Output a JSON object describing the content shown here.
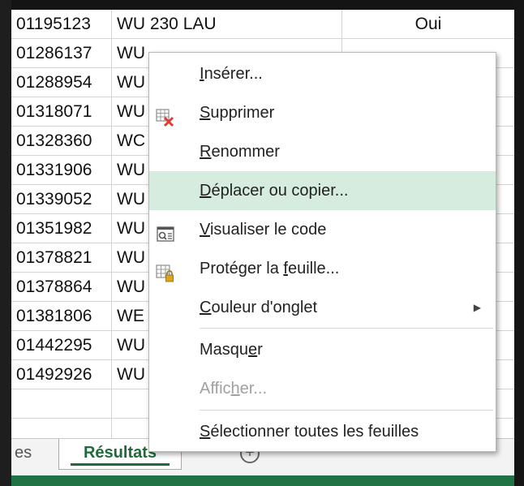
{
  "rows": [
    {
      "id": "01195123",
      "name": "WU 230 LAU",
      "value": "Oui"
    },
    {
      "id": "01286137",
      "name": "WU",
      "value": ""
    },
    {
      "id": "01288954",
      "name": "WU",
      "value": ""
    },
    {
      "id": "01318071",
      "name": "WU",
      "value": ""
    },
    {
      "id": "01328360",
      "name": "WC",
      "value": ""
    },
    {
      "id": "01331906",
      "name": "WU",
      "value": ""
    },
    {
      "id": "01339052",
      "name": "WU",
      "value": ""
    },
    {
      "id": "01351982",
      "name": "WU",
      "value": ""
    },
    {
      "id": "01378821",
      "name": "WU",
      "value": ""
    },
    {
      "id": "01378864",
      "name": "WU",
      "value": ""
    },
    {
      "id": "01381806",
      "name": "WE",
      "value": ""
    },
    {
      "id": "01442295",
      "name": "WU",
      "value": ""
    },
    {
      "id": "01492926",
      "name": "WU",
      "value": ""
    },
    {
      "id": "",
      "name": "",
      "value": ""
    },
    {
      "id": "",
      "name": "",
      "value": ""
    }
  ],
  "tabs": {
    "previous_partial": "es",
    "active": "Résultats",
    "add_symbol": "+"
  },
  "menu": {
    "insert": {
      "pre": "",
      "ul": "I",
      "post": "nsérer..."
    },
    "delete": {
      "pre": "",
      "ul": "S",
      "post": "upprimer"
    },
    "rename": {
      "pre": "",
      "ul": "R",
      "post": "enommer"
    },
    "move_copy": {
      "pre": "",
      "ul": "D",
      "post": "éplacer ou copier..."
    },
    "view_code": {
      "pre": "",
      "ul": "V",
      "post": "isualiser le code"
    },
    "protect": {
      "pre": "Protéger la ",
      "ul": "f",
      "post": "euille..."
    },
    "tab_color": {
      "pre": "",
      "ul": "C",
      "post": "ouleur d'onglet"
    },
    "hide": {
      "pre": "Masqu",
      "ul": "e",
      "post": "r"
    },
    "unhide": {
      "pre": "Affic",
      "ul": "h",
      "post": "er..."
    },
    "select_all": {
      "pre": "",
      "ul": "S",
      "post": "électionner toutes les feuilles"
    },
    "submenu_arrow": "▶"
  },
  "colors": {
    "highlight": "#d6ecdf",
    "excel_green": "#217346",
    "delete_x": "#e03c31",
    "lock": "#e0a21b"
  },
  "icons": {
    "delete": "delete-sheet-icon",
    "view_code": "view-code-icon",
    "protect": "protect-sheet-icon"
  }
}
